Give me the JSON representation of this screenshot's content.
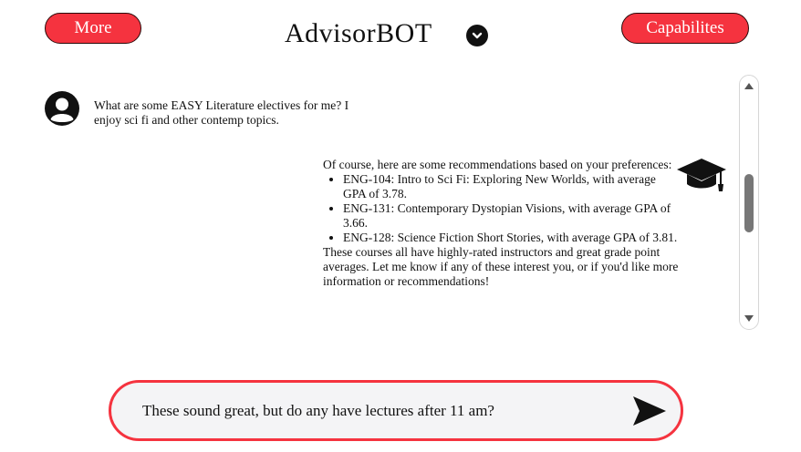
{
  "header": {
    "more_label": "More",
    "title": "AdvisorBOT",
    "capabilities_label": "Capabilites"
  },
  "chat": {
    "user_message": "What are some EASY Literature electives for me? I enjoy sci fi and other contemp topics.",
    "bot_intro": "Of course, here are some recommendations based on your preferences:",
    "bot_items": [
      "ENG-104: Intro to Sci Fi: Exploring New Worlds, with average GPA of 3.78.",
      "ENG-131: Contemporary Dystopian Visions, with average GPA of 3.66.",
      "ENG-128: Science Fiction Short Stories, with average GPA of 3.81."
    ],
    "bot_outro": "These courses all have highly-rated instructors and great grade point averages. Let me know if any of these interest you, or if you'd like more information or recommendations!"
  },
  "composer": {
    "value": "These sound great, but do any have lectures after 11 am?"
  },
  "icons": {
    "user": "user-avatar-icon",
    "bot": "graduation-cap-icon",
    "dropdown": "chevron-down-icon",
    "send": "send-icon"
  },
  "colors": {
    "accent": "#f5333f",
    "input_bg": "#f4f4f6"
  }
}
